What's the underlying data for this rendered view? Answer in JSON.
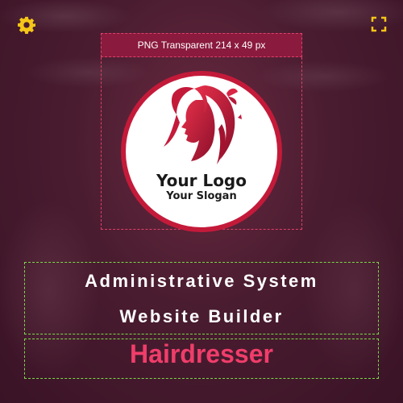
{
  "toolbar": {
    "settings_icon": "gear-icon",
    "fullscreen_icon": "fullscreen-icon"
  },
  "logo_area": {
    "caption": "PNG Transparent 214 x 49 px",
    "name": "Your Logo",
    "slogan": "Your Slogan",
    "accent_color": "#c41a3a"
  },
  "headline": {
    "line1": "Administrative System",
    "line2": "Website Builder",
    "subtitle": "Hairdresser",
    "subtitle_color": "#f03d6a"
  }
}
